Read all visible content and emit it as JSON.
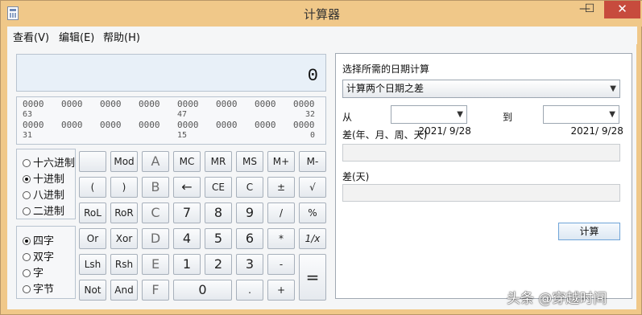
{
  "window": {
    "title": "计算器",
    "minimize": "—",
    "maximize": "☐",
    "close": "✕"
  },
  "menu": [
    "查看(V)",
    "编辑(E)",
    "帮助(H)"
  ],
  "display": {
    "value": "0"
  },
  "bits": {
    "row1": [
      "0000",
      "0000",
      "0000",
      "0000",
      "0000",
      "0000",
      "0000",
      "0000"
    ],
    "row1_nums": [
      "63",
      "47",
      "32"
    ],
    "row2": [
      "0000",
      "0000",
      "0000",
      "0000",
      "0000",
      "0000",
      "0000",
      "0000"
    ],
    "row2_nums": [
      "31",
      "15",
      "0"
    ]
  },
  "base": {
    "options": [
      "十六进制",
      "十进制",
      "八进制",
      "二进制"
    ],
    "selected": 1
  },
  "word": {
    "options": [
      "四字",
      "双字",
      "字",
      "字节"
    ],
    "selected": 0
  },
  "keys": [
    [
      "",
      "Mod",
      "A",
      "MC",
      "MR",
      "MS",
      "M+",
      "M-"
    ],
    [
      "(",
      ")",
      "B",
      "←",
      "CE",
      "C",
      "±",
      "√"
    ],
    [
      "RoL",
      "RoR",
      "C",
      "7",
      "8",
      "9",
      "/",
      "%"
    ],
    [
      "Or",
      "Xor",
      "D",
      "4",
      "5",
      "6",
      "*",
      "1/x"
    ],
    [
      "Lsh",
      "Rsh",
      "E",
      "1",
      "2",
      "3",
      "-",
      "="
    ],
    [
      "Not",
      "And",
      "F",
      "0",
      ".",
      "+"
    ]
  ],
  "date": {
    "heading": "选择所需的日期计算",
    "mode": "计算两个日期之差",
    "from_label": "从",
    "from_value": "2021/ 9/28",
    "to_label": "到",
    "to_value": "2021/ 9/28",
    "diff_ymwd_label": "差(年、月、周、天)",
    "diff_days_label": "差(天)",
    "calc_button": "计算"
  },
  "watermark": "头条 @穿越时间"
}
